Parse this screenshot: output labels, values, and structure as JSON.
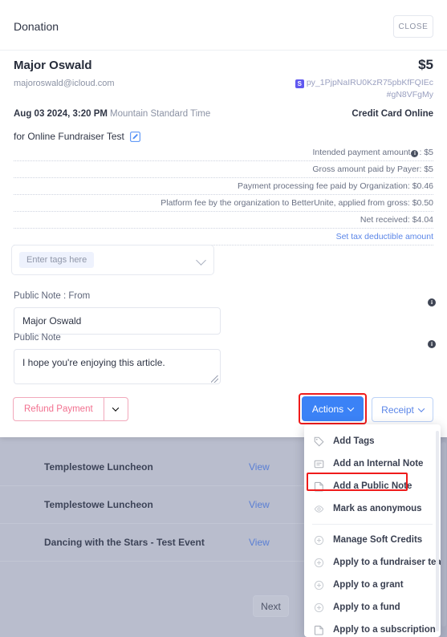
{
  "header": {
    "title": "Donation",
    "close_label": "CLOSE"
  },
  "donor": {
    "name": "Major Oswald",
    "amount": "$5",
    "email": "majoroswald@icloud.com",
    "transaction_badge": "S",
    "transaction_id_line1": "py_1PjpNaIRU0KzR75pbKfFQIEc",
    "transaction_id_line2": "#gN8VFgMy"
  },
  "meta": {
    "date": "Aug 03 2024, 3:20 PM",
    "timezone": "Mountain Standard Time",
    "method": "Credit Card Online",
    "for_label": "for Online Fundraiser Test",
    "edit_icon": "edit-pencil-icon"
  },
  "fees": {
    "rows": [
      {
        "label": "Intended payment amount",
        "has_info": true,
        "value": "$5"
      },
      {
        "label": "Gross amount paid by Payer",
        "has_info": false,
        "value": "$5"
      },
      {
        "label": "Payment processing fee paid by Organization",
        "has_info": false,
        "value": "$0.46"
      },
      {
        "label": "Platform fee by the organization to BetterUnite, applied from gross",
        "has_info": false,
        "value": "$0.50"
      },
      {
        "label": "Net received",
        "has_info": false,
        "value": "$4.04"
      }
    ],
    "link_label": "Set tax deductible amount"
  },
  "tags": {
    "placeholder": "Enter tags here",
    "chevron": "chevron-down-icon"
  },
  "public_note_from": {
    "label": "Public Note : From",
    "value": "Major Oswald",
    "info": "i"
  },
  "public_note": {
    "label": "Public Note",
    "value": "I hope you're enjoying this article.",
    "info": "i"
  },
  "footer": {
    "refund_label": "Refund Payment",
    "actions_label": "Actions",
    "receipt_label": "Receipt"
  },
  "menu": {
    "group1": [
      {
        "label": "Add Tags",
        "icon": "tag-icon"
      },
      {
        "label": "Add an Internal Note",
        "icon": "note-lines-icon"
      },
      {
        "label": "Add a Public Note",
        "icon": "document-icon",
        "highlighted": true
      },
      {
        "label": "Mark as anonymous",
        "icon": "eye-icon"
      }
    ],
    "group2": [
      {
        "label": "Manage Soft Credits",
        "icon": "plus-circle-icon"
      },
      {
        "label": "Apply to a fundraiser team",
        "icon": "plus-circle-icon"
      },
      {
        "label": "Apply to a grant",
        "icon": "plus-circle-icon"
      },
      {
        "label": "Apply to a fund",
        "icon": "plus-circle-icon"
      },
      {
        "label": "Apply to a subscription",
        "icon": "document-icon"
      }
    ]
  },
  "background": {
    "rows": [
      {
        "title": "Templestowe Luncheon",
        "action": "View"
      },
      {
        "title": "Templestowe Luncheon",
        "action": "View"
      },
      {
        "title": "Dancing with the Stars - Test Event",
        "action": "View"
      }
    ],
    "next_label": "Next"
  },
  "colors": {
    "accent_blue": "#3b82f6",
    "link_blue": "#5b86e8",
    "refund_pink": "#f2708f",
    "highlight_red": "#ef1b1b",
    "stripe_purple": "#6058f0"
  }
}
